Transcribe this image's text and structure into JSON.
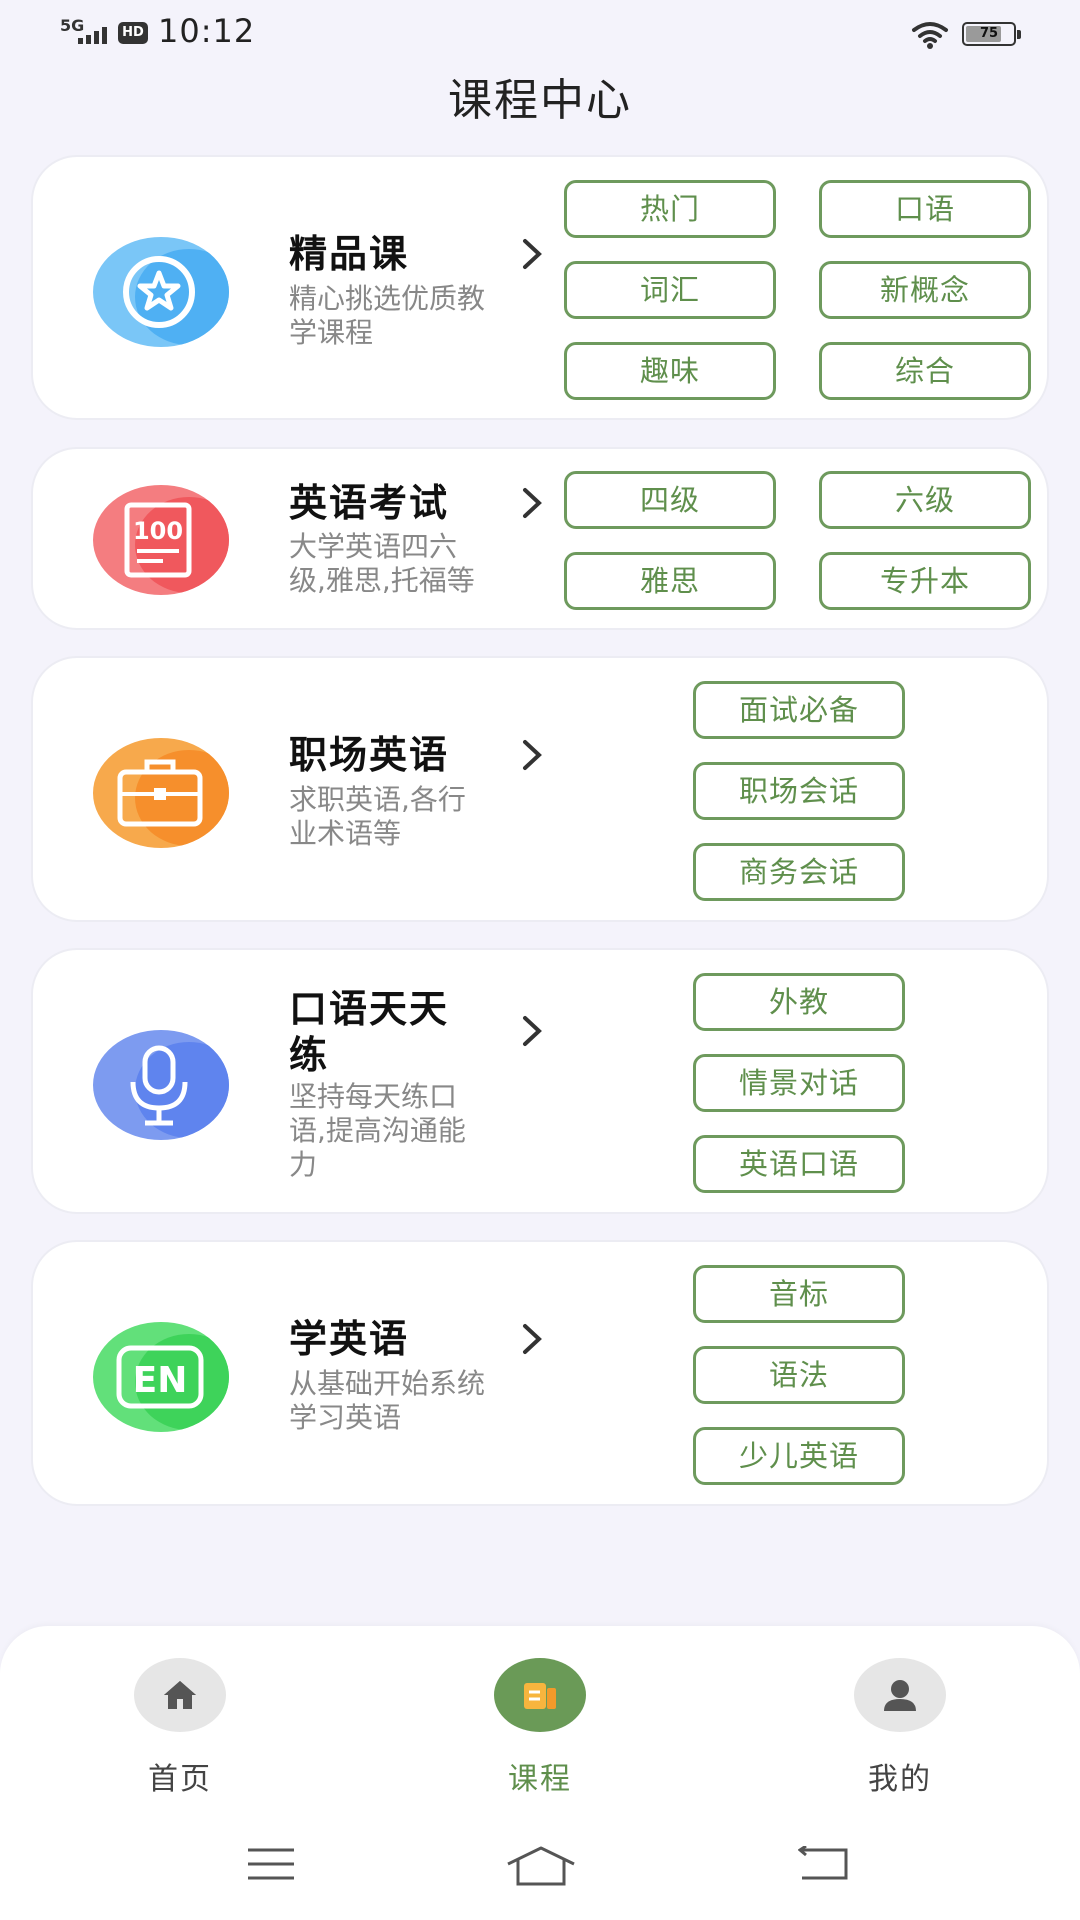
{
  "status_bar": {
    "network": "5G",
    "hd": "HD",
    "time": "10:12",
    "battery": "75",
    "battery_level": 0.75
  },
  "page_title": "课程中心",
  "colors": {
    "accent_green": "#5f8f4c",
    "tag_border": "#6e9a5d",
    "nav_active": "#6a9a57"
  },
  "cards": [
    {
      "icon": "star-badge-icon",
      "icon_color": "#7ac6f7",
      "title": "精品课",
      "desc_lines": [
        "精心挑选优质教",
        "学课程"
      ],
      "tags": [
        "热门",
        "口语",
        "词汇",
        "新概念",
        "趣味",
        "综合"
      ]
    },
    {
      "icon": "exam-score-100-icon",
      "icon_color": "#f47d80",
      "title": "英语考试",
      "desc_lines": [
        "大学英语四六",
        "级,雅思,托福等"
      ],
      "tags": [
        "四级",
        "六级",
        "雅思",
        "专升本"
      ]
    },
    {
      "icon": "briefcase-icon",
      "icon_color": "#f7a94c",
      "title": "职场英语",
      "desc_lines": [
        "求职英语,各行",
        "业术语等"
      ],
      "tags": [
        "面试必备",
        "职场会话",
        "商务会话"
      ]
    },
    {
      "icon": "microphone-icon",
      "icon_color": "#7d9bf0",
      "title_lines": [
        "口语天天",
        "练"
      ],
      "desc_lines": [
        "坚持每天练口",
        "语,提高沟通能",
        "力"
      ],
      "tags": [
        "外教",
        "情景对话",
        "英语口语"
      ]
    },
    {
      "icon": "en-letters-icon",
      "icon_color": "#62e07a",
      "title": "学英语",
      "desc_lines": [
        "从基础开始系统",
        "学习英语"
      ],
      "tags": [
        "音标",
        "语法",
        "少儿英语"
      ]
    }
  ],
  "bottom_nav": [
    {
      "label": "首页",
      "icon": "home-icon",
      "active": false
    },
    {
      "label": "课程",
      "icon": "course-book-icon",
      "active": true
    },
    {
      "label": "我的",
      "icon": "person-icon",
      "active": false
    }
  ],
  "system_nav": [
    "menu-lines-icon",
    "home-outline-icon",
    "back-icon"
  ]
}
